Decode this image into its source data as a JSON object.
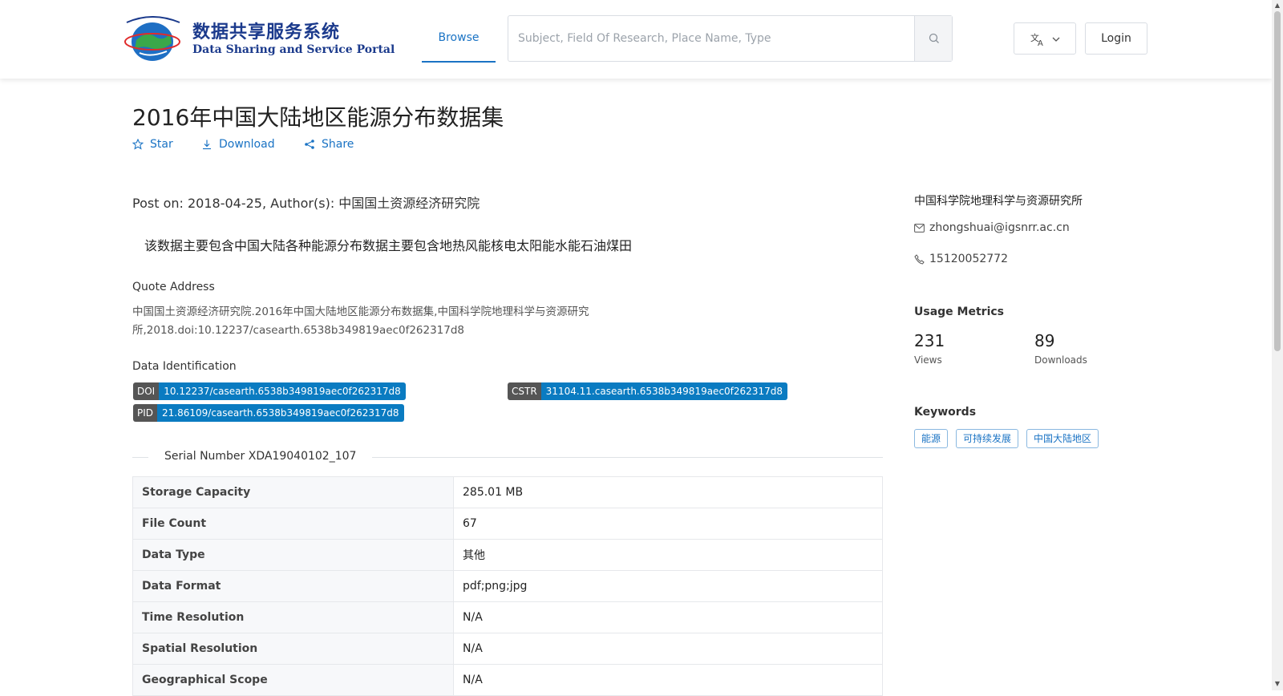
{
  "header": {
    "logo_cn": "数据共享服务系统",
    "logo_en": "Data Sharing and Service Portal",
    "nav_browse": "Browse",
    "search_placeholder": "Subject, Field Of Research, Place Name, Type",
    "login": "Login"
  },
  "dataset": {
    "title": "2016年中国大陆地区能源分布数据集",
    "actions": {
      "star": "Star",
      "download": "Download",
      "share": "Share"
    },
    "post_line": "Post on: 2018-04-25, Author(s): 中国国土资源经济研究院",
    "description": "该数据主要包含中国大陆各种能源分布数据主要包含地热风能核电太阳能水能石油煤田",
    "quote_heading": "Quote Address",
    "quote_text": "中国国土资源经济研究院.2016年中国大陆地区能源分布数据集,中国科学院地理科学与资源研究所,2018.doi:10.12237/casearth.6538b349819aec0f262317d8",
    "identification_heading": "Data Identification",
    "identifiers": {
      "doi_label": "DOI",
      "doi_value": "10.12237/casearth.6538b349819aec0f262317d8",
      "cstr_label": "CSTR",
      "cstr_value": "31104.11.casearth.6538b349819aec0f262317d8",
      "pid_label": "PID",
      "pid_value": "21.86109/casearth.6538b349819aec0f262317d8"
    },
    "serial": "Serial Number XDA19040102_107",
    "properties": [
      {
        "key": "Storage Capacity",
        "value": "285.01 MB"
      },
      {
        "key": "File Count",
        "value": "67"
      },
      {
        "key": "Data Type",
        "value": "其他"
      },
      {
        "key": "Data Format",
        "value": "pdf;png;jpg"
      },
      {
        "key": "Time Resolution",
        "value": "N/A"
      },
      {
        "key": "Spatial Resolution",
        "value": "N/A"
      },
      {
        "key": "Geographical Scope",
        "value": "N/A"
      }
    ]
  },
  "sidebar": {
    "institution": "中国科学院地理科学与资源研究所",
    "email": "zhongshuai@igsnrr.ac.cn",
    "phone": "15120052772",
    "metrics_heading": "Usage Metrics",
    "views_value": "231",
    "views_label": "Views",
    "downloads_value": "89",
    "downloads_label": "Downloads",
    "keywords_heading": "Keywords",
    "keywords": [
      "能源",
      "可持续发展",
      "中国大陆地区"
    ]
  },
  "colors": {
    "accent": "#1a73c4",
    "badge_value": "#0a7bc1",
    "badge_key": "#555555",
    "logo": "#1b3a8c"
  },
  "icons": [
    "globe-logo-icon",
    "search-icon",
    "translate-icon",
    "chevron-down-icon",
    "star-icon",
    "download-icon",
    "share-icon",
    "mail-icon",
    "phone-icon"
  ]
}
